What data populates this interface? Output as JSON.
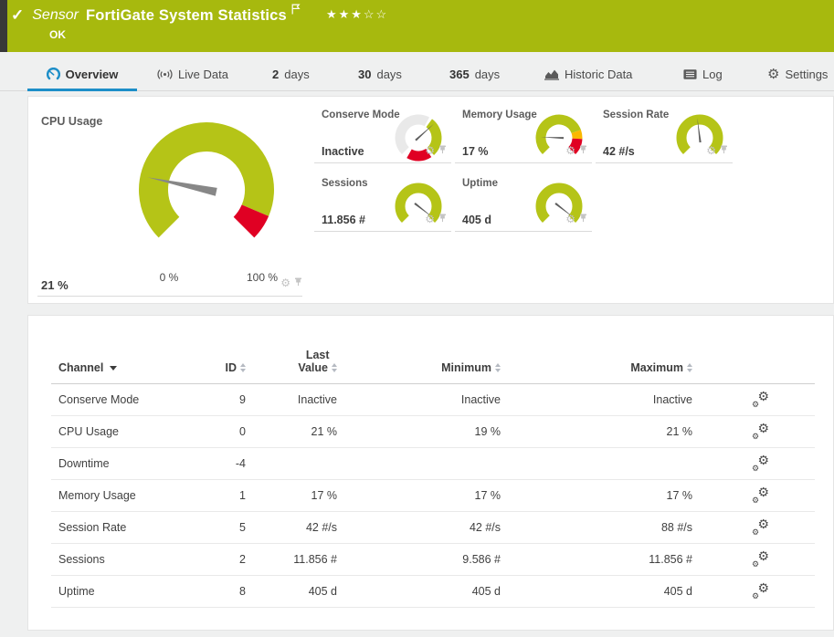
{
  "colors": {
    "header_green": "#a7b90e",
    "accent_blue": "#1d8ec8",
    "green": "#b5c417",
    "red": "#e00023",
    "yellow": "#fab800",
    "gray": "#e9e9e9"
  },
  "icons": {
    "check": "✓",
    "gear": "⚙",
    "star_filled": "★",
    "star_empty": "☆"
  },
  "header": {
    "kind": "Sensor",
    "title": "FortiGate System Statistics",
    "status": "OK",
    "stars": "★★★☆☆"
  },
  "tabs": {
    "overview": {
      "label": "Overview"
    },
    "live": {
      "label": "Live Data"
    },
    "d2": {
      "num": "2",
      "label": "days"
    },
    "d30": {
      "num": "30",
      "label": "days"
    },
    "d365": {
      "num": "365",
      "label": "days"
    },
    "historic": {
      "label": "Historic Data"
    },
    "log": {
      "label": "Log"
    },
    "settings": {
      "label": "Settings"
    }
  },
  "gauges": {
    "main": {
      "title": "CPU Usage",
      "value": "21 %",
      "scale_min": "0 %",
      "scale_max": "100 %",
      "needle_deg": 168,
      "segments": [
        {
          "start": 225,
          "end": -23,
          "color": "green"
        },
        {
          "start": -23,
          "end": -45,
          "color": "red"
        }
      ]
    },
    "tiles": [
      {
        "title": "Conserve Mode",
        "value": "Inactive",
        "needle_deg": 42,
        "segments": [
          {
            "start": 225,
            "end": 62,
            "color": "gray"
          },
          {
            "start": 54,
            "end": -48,
            "color": "green"
          },
          {
            "start": -56,
            "end": -120,
            "color": "red"
          }
        ]
      },
      {
        "title": "Memory Usage",
        "value": "17 %",
        "needle_deg": 178,
        "segments": [
          {
            "start": 225,
            "end": 20,
            "color": "green"
          },
          {
            "start": 20,
            "end": -3,
            "color": "yellow"
          },
          {
            "start": -3,
            "end": -45,
            "color": "red"
          }
        ]
      },
      {
        "title": "Session Rate",
        "value": "42 #/s",
        "needle_deg": 97,
        "segments": [
          {
            "start": 225,
            "end": -45,
            "color": "green"
          }
        ]
      },
      {
        "title": "Sessions",
        "value": "11.856 #",
        "needle_deg": -38,
        "segments": [
          {
            "start": 225,
            "end": -45,
            "color": "green"
          }
        ]
      },
      {
        "title": "Uptime",
        "value": "405 d",
        "needle_deg": -38,
        "segments": [
          {
            "start": 225,
            "end": -45,
            "color": "green"
          }
        ]
      }
    ]
  },
  "chart_data": [
    {
      "type": "gauge",
      "title": "CPU Usage",
      "value": 21,
      "unit": "%",
      "range": [
        0,
        100
      ]
    },
    {
      "type": "gauge",
      "title": "Conserve Mode",
      "value": "Inactive"
    },
    {
      "type": "gauge",
      "title": "Memory Usage",
      "value": 17,
      "unit": "%"
    },
    {
      "type": "gauge",
      "title": "Session Rate",
      "value": 42,
      "unit": "#/s"
    },
    {
      "type": "gauge",
      "title": "Sessions",
      "value": 11856,
      "unit": "#"
    },
    {
      "type": "gauge",
      "title": "Uptime",
      "value": 405,
      "unit": "d"
    }
  ],
  "table": {
    "columns": {
      "channel": {
        "label": "Channel"
      },
      "id": {
        "label": "ID"
      },
      "last": {
        "label": "Last",
        "label2": "Value"
      },
      "min": {
        "label": "Minimum"
      },
      "max": {
        "label": "Maximum"
      }
    },
    "rows": [
      {
        "channel": "Conserve Mode",
        "id": "9",
        "last": "Inactive",
        "min": "Inactive",
        "max": "Inactive"
      },
      {
        "channel": "CPU Usage",
        "id": "0",
        "last": "21 %",
        "min": "19 %",
        "max": "21 %"
      },
      {
        "channel": "Downtime",
        "id": "-4",
        "last": "",
        "min": "",
        "max": ""
      },
      {
        "channel": "Memory Usage",
        "id": "1",
        "last": "17 %",
        "min": "17 %",
        "max": "17 %"
      },
      {
        "channel": "Session Rate",
        "id": "5",
        "last": "42 #/s",
        "min": "42 #/s",
        "max": "88 #/s"
      },
      {
        "channel": "Sessions",
        "id": "2",
        "last": "11.856 #",
        "min": "9.586 #",
        "max": "11.856 #"
      },
      {
        "channel": "Uptime",
        "id": "8",
        "last": "405 d",
        "min": "405 d",
        "max": "405 d"
      }
    ]
  }
}
